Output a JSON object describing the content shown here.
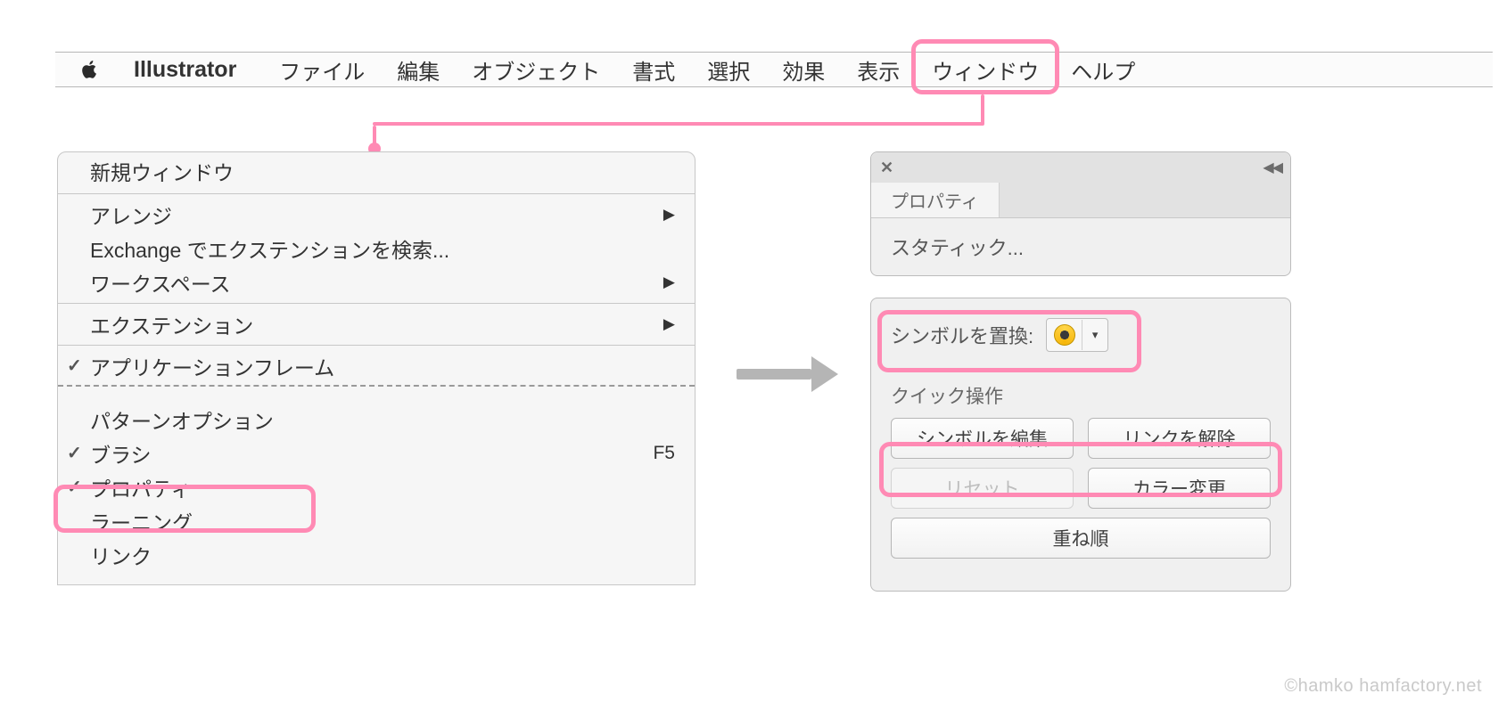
{
  "menubar": {
    "app": "Illustrator",
    "items": [
      "ファイル",
      "編集",
      "オブジェクト",
      "書式",
      "選択",
      "効果",
      "表示",
      "ウィンドウ",
      "ヘルプ"
    ]
  },
  "dropdown": {
    "new_window": "新規ウィンドウ",
    "arrange": "アレンジ",
    "exchange": "Exchange でエクステンションを検索...",
    "workspace": "ワークスペース",
    "extension": "エクステンション",
    "app_frame": "アプリケーションフレーム",
    "pattern_options": "パターンオプション",
    "brush": "ブラシ",
    "brush_shortcut": "F5",
    "property": "プロパティ",
    "learning": "ラーニング",
    "link": "リンク"
  },
  "panel": {
    "tab": "プロパティ",
    "static": "スタティック...",
    "replace_label": "シンボルを置換:",
    "quick_header": "クイック操作",
    "edit_symbol": "シンボルを編集",
    "unlink": "リンクを解除",
    "reset": "リセット",
    "recolor": "カラー変更",
    "arrange": "重ね順"
  },
  "watermark": "©hamko  hamfactory.net"
}
